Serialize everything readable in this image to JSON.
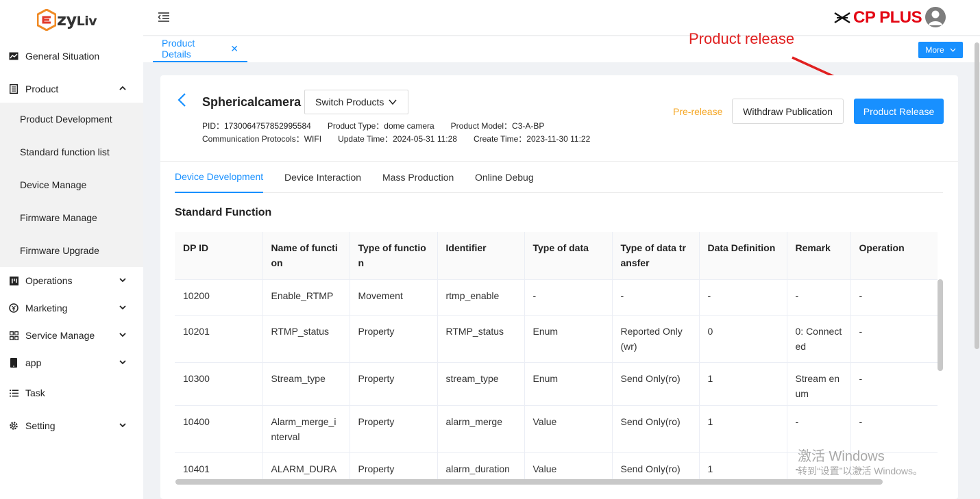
{
  "sidebar": {
    "logo": "ezyLiv",
    "items": [
      {
        "label": "General Situation",
        "icon": "line-chart-icon"
      },
      {
        "label": "Product",
        "icon": "document-icon"
      },
      {
        "label": "Operations",
        "icon": "bar-chart-icon"
      },
      {
        "label": "Marketing",
        "icon": "currency-icon"
      },
      {
        "label": "Service Manage",
        "icon": "grid-icon"
      },
      {
        "label": "app",
        "icon": "phone-icon"
      },
      {
        "label": "Task",
        "icon": "list-icon"
      },
      {
        "label": "Setting",
        "icon": "gear-icon"
      }
    ],
    "product_submenu": [
      "Product Development",
      "Standard function list",
      "Device Manage",
      "Firmware Manage",
      "Firmware Upgrade"
    ]
  },
  "header": {
    "brand": "CP PLUS"
  },
  "tabbar": {
    "active_tab": "Product Details",
    "more_label": "More"
  },
  "annotation": {
    "text": "Product release",
    "color": "#e02020"
  },
  "product": {
    "name": "Sphericalcamera",
    "switch_label": "Switch Products",
    "pid": "PID：1730064757852995584",
    "type": "Product Type：dome camera",
    "model": "Product Model：C3-A-BP",
    "protocols": "Communication Protocols：WIFI",
    "update_time": "Update Time：2024-05-31 11:28",
    "create_time": "Create Time：2023-11-30 11:22",
    "status": "Pre-release",
    "withdraw_label": "Withdraw Publication",
    "release_label": "Product Release"
  },
  "subtabs": [
    "Device Development",
    "Device Interaction",
    "Mass Production",
    "Online Debug"
  ],
  "section_title": "Standard Function",
  "table": {
    "columns": [
      "DP ID",
      "Name of function",
      "Type of function",
      "Identifier",
      "Type of data",
      "Type of data transfer",
      "Data Definition",
      "Remark",
      "Operation"
    ],
    "rows": [
      [
        "10200",
        "Enable_RTMP",
        "Movement",
        "rtmp_enable",
        "-",
        "-",
        "-",
        "-",
        "-"
      ],
      [
        "10201",
        "RTMP_status",
        "Property",
        "RTMP_status",
        "Enum",
        "Reported Only(wr)",
        "0",
        "0: Connected",
        "-"
      ],
      [
        "10300",
        "Stream_type",
        "Property",
        "stream_type",
        "Enum",
        "Send Only(ro)",
        "1",
        "Stream enum",
        "-"
      ],
      [
        "10400",
        "Alarm_merge_interval",
        "Property",
        "alarm_merge",
        "Value",
        "Send Only(ro)",
        "1",
        "-",
        "-"
      ],
      [
        "10401",
        "ALARM_DURATION",
        "Property",
        "alarm_duration",
        "Value",
        "Send Only(ro)",
        "1",
        "-",
        "-"
      ]
    ]
  },
  "watermark": {
    "line1": "激活 Windows",
    "line2": "转到“设置”以激活 Windows。"
  },
  "colors": {
    "accent": "#1890ff",
    "prerelease": "#f5a623",
    "brand_red": "#e30613"
  }
}
